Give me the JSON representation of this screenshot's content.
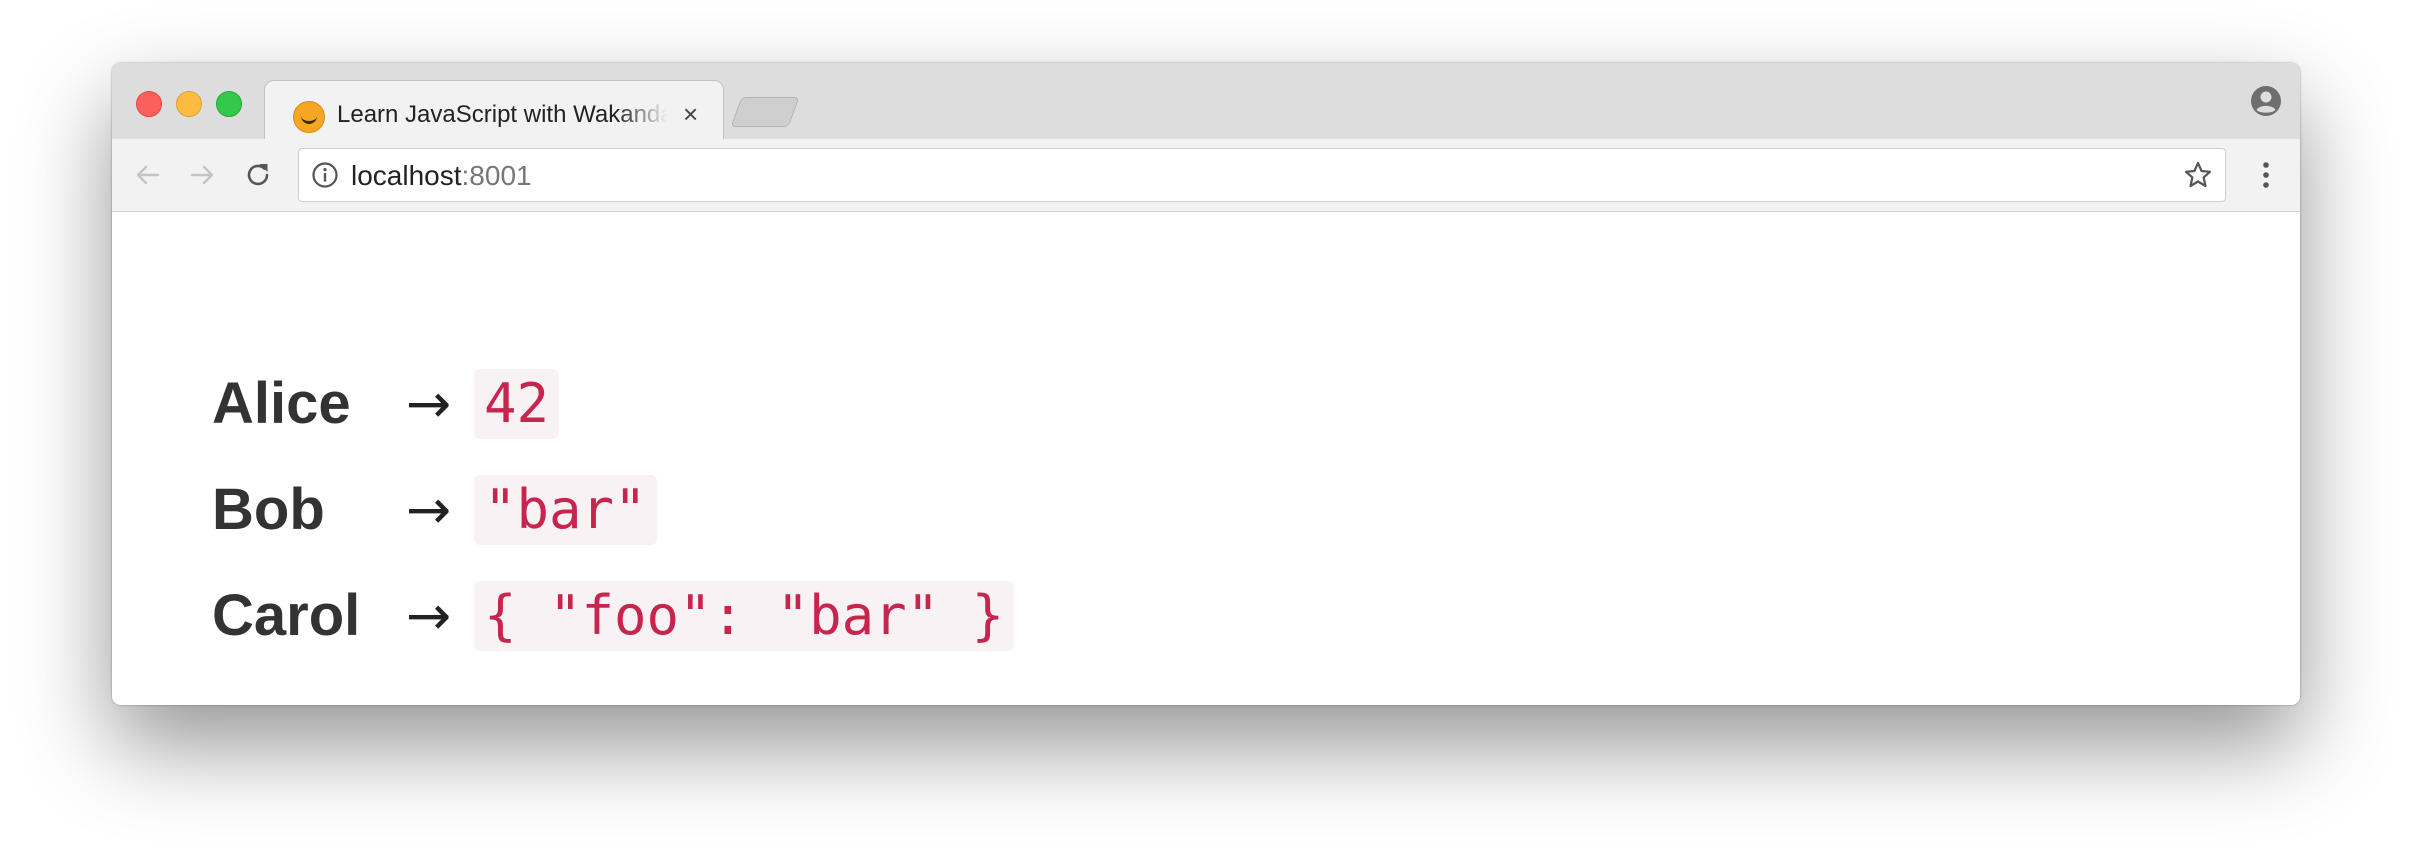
{
  "browser": {
    "tab": {
      "title": "Learn JavaScript with Wakanda",
      "close_glyph": "×",
      "favicon": "wakanda-logo-icon"
    },
    "address_bar": {
      "host": "localhost",
      "port": ":8001"
    },
    "icons": {
      "back": "arrow-left-icon",
      "forward": "arrow-right-icon",
      "reload": "reload-icon",
      "info": "info-icon",
      "bookmark": "star-icon",
      "menu": "kebab-menu-icon",
      "profile": "profile-icon"
    }
  },
  "page": {
    "rows": [
      {
        "name": "Alice",
        "arrow": "→",
        "value": "42"
      },
      {
        "name": "Bob",
        "arrow": "→",
        "value": "\"bar\""
      },
      {
        "name": "Carol",
        "arrow": "→",
        "value": "{ \"foo\": \"bar\" }"
      }
    ]
  },
  "colors": {
    "code_text": "#c7254e",
    "code_background": "#f9f2f4",
    "name_text": "#333333",
    "traffic_close": "#fc605c",
    "traffic_minimize": "#fdbc40",
    "traffic_maximize": "#34c84a"
  }
}
